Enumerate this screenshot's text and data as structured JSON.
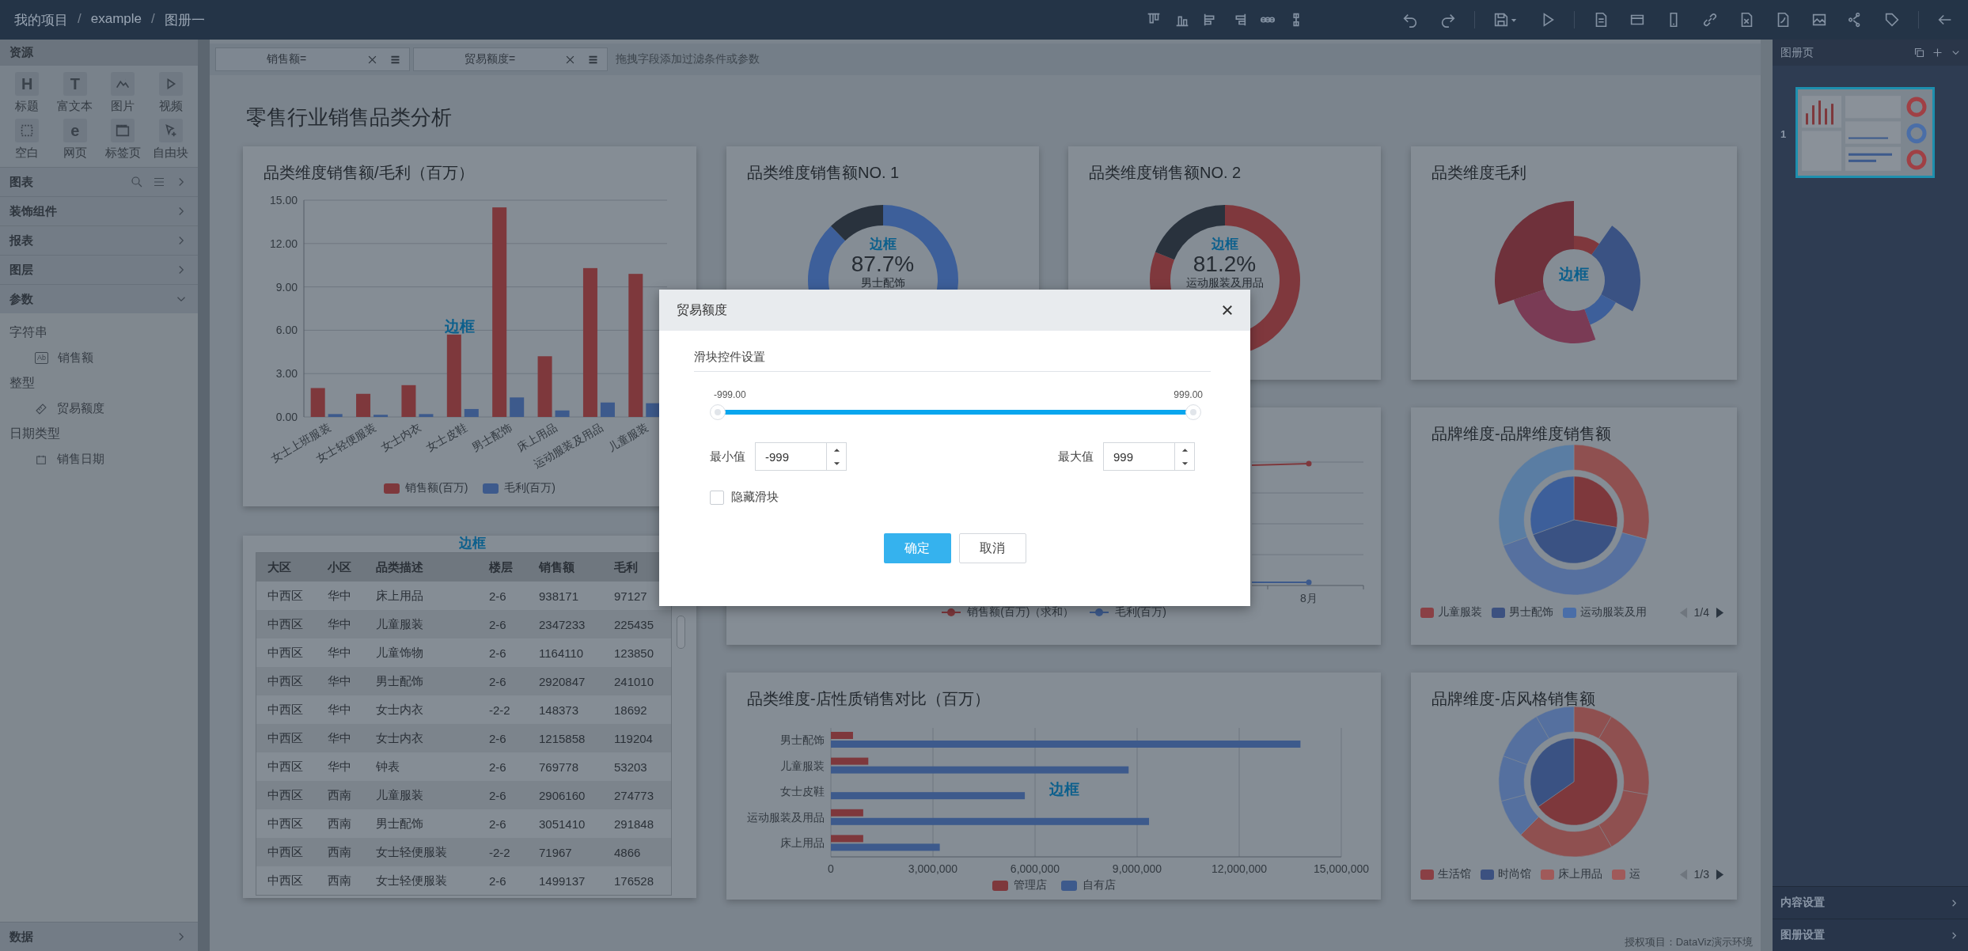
{
  "topbar": {
    "breadcrumb": [
      {
        "text": "我的项目",
        "kind": "link"
      },
      {
        "text": "/",
        "kind": "separator"
      },
      {
        "text": "example",
        "kind": "link"
      },
      {
        "text": "/",
        "kind": "separator"
      },
      {
        "text": "图册一",
        "kind": "current"
      }
    ]
  },
  "sidebar": {
    "title": "资源",
    "widgets": [
      {
        "label": "标题",
        "kind": "glyph",
        "glyph": "H"
      },
      {
        "label": "富文本",
        "kind": "glyph",
        "glyph": "T"
      },
      {
        "label": "图片",
        "kind": "image"
      },
      {
        "label": "视频",
        "kind": "video"
      },
      {
        "label": "空白",
        "kind": "blank"
      },
      {
        "label": "网页",
        "kind": "glyph",
        "glyph": "e"
      },
      {
        "label": "标签页",
        "kind": "tab"
      },
      {
        "label": "自由块",
        "kind": "free"
      }
    ],
    "sections": [
      {
        "label": "图表",
        "kind": "tools",
        "expanded": false
      },
      {
        "label": "装饰组件",
        "kind": "plain",
        "expanded": false
      },
      {
        "label": "报表",
        "kind": "plain",
        "expanded": false
      },
      {
        "label": "图层",
        "kind": "plain",
        "expanded": false
      },
      {
        "label": "参数",
        "kind": "plain",
        "expanded": true,
        "children": [
          {
            "label": "字符串",
            "children": [
              {
                "label": "销售额",
                "kind": "text",
                "glyph": "Ab"
              }
            ]
          },
          {
            "label": "整型",
            "children": [
              {
                "label": "贸易额度",
                "kind": "number"
              }
            ]
          },
          {
            "label": "日期类型",
            "children": [
              {
                "label": "销售日期",
                "kind": "date"
              }
            ]
          }
        ]
      }
    ],
    "footer": {
      "label": "数据",
      "expanded": false
    }
  },
  "filters": {
    "chips": [
      {
        "label": "销售额="
      },
      {
        "label": "贸易额度="
      }
    ],
    "hint": "拖拽字段添加过滤条件或参数"
  },
  "page": {
    "title": "零售行业销售品类分析",
    "bar_card": {
      "overlay": "边框",
      "chart_data": {
        "type": "bar",
        "title": "品类维度销售额/毛利（百万）",
        "categories": [
          "女士上班服装",
          "女士轻便服装",
          "女士内衣",
          "女士皮鞋",
          "男士配饰",
          "床上用品",
          "运动服装及用品",
          "儿童服装"
        ],
        "series": [
          {
            "name": "销售额(百万)",
            "color": "#7e383c",
            "values": [
              2.0,
              1.6,
              2.2,
              5.7,
              14.5,
              4.2,
              10.3,
              9.9
            ]
          },
          {
            "name": "毛利(百万)",
            "color": "#3d5a8c",
            "values": [
              0.2,
              0.15,
              0.2,
              0.55,
              1.35,
              0.45,
              1.0,
              0.95
            ]
          }
        ],
        "grid": true,
        "ylim": [
          0,
          15
        ],
        "yticks": [
          {
            "value": 0,
            "label": "0.00"
          },
          {
            "value": 3,
            "label": "3.00"
          },
          {
            "value": 6,
            "label": "6.00"
          },
          {
            "value": 9,
            "label": "9.00"
          },
          {
            "value": 12,
            "label": "12.00"
          },
          {
            "value": 15,
            "label": "15.00"
          }
        ]
      }
    },
    "donut_cards": [
      {
        "title": "品类维度销售额NO. 1",
        "overlay": "边框",
        "percent": "87.7%",
        "name": "男士配饰"
      },
      {
        "title": "品类维度销售额NO. 2",
        "overlay": "边框",
        "percent": "81.2%",
        "name": "运动服装及用品"
      }
    ],
    "rose_card": {
      "title": "品类维度毛利",
      "overlay": "边框"
    },
    "line_card": {
      "x_label": "8月",
      "legend": [
        {
          "name": "销售额(百万)（求和）",
          "color": "#7e383c"
        },
        {
          "name": "毛利(百万)",
          "color": "#3d5a8c"
        }
      ]
    },
    "brand_card": {
      "title": "品牌维度-品牌维度销售额",
      "legend": [
        {
          "name": "儿童服装",
          "color": "#8a4045"
        },
        {
          "name": "男士配饰",
          "color": "#3c5180"
        },
        {
          "name": "运动服装及用",
          "color": "#4a6ea8"
        }
      ],
      "pager": "1/4"
    },
    "table_card": {
      "overlay": "边框",
      "columns": [
        "大区",
        "小区",
        "品类描述",
        "楼层",
        "销售额",
        "毛利"
      ],
      "rows": [
        [
          "中西区",
          "华中",
          "床上用品",
          "2-6",
          "938171",
          "97127"
        ],
        [
          "中西区",
          "华中",
          "儿童服装",
          "2-6",
          "2347233",
          "225435"
        ],
        [
          "中西区",
          "华中",
          "儿童饰物",
          "2-6",
          "1164110",
          "123850"
        ],
        [
          "中西区",
          "华中",
          "男士配饰",
          "2-6",
          "2920847",
          "241010"
        ],
        [
          "中西区",
          "华中",
          "女士内衣",
          "-2-2",
          "148373",
          "18692"
        ],
        [
          "中西区",
          "华中",
          "女士内衣",
          "2-6",
          "1215858",
          "119204"
        ],
        [
          "中西区",
          "华中",
          "钟表",
          "2-6",
          "769778",
          "53203"
        ],
        [
          "中西区",
          "西南",
          "儿童服装",
          "2-6",
          "2906160",
          "274773"
        ],
        [
          "中西区",
          "西南",
          "男士配饰",
          "2-6",
          "3051410",
          "291848"
        ],
        [
          "中西区",
          "西南",
          "女士轻便服装",
          "-2-2",
          "71967",
          "4866"
        ],
        [
          "中西区",
          "西南",
          "女士轻便服装",
          "2-6",
          "1499137",
          "176528"
        ]
      ]
    },
    "hbar_card": {
      "overlay": "边框",
      "chart_data": {
        "type": "bar",
        "orientation": "horizontal",
        "title": "品类维度-店性质销售对比（百万）",
        "categories": [
          "男士配饰",
          "儿童服装",
          "女士皮鞋",
          "运动服装及用品",
          "床上用品"
        ],
        "series": [
          {
            "name": "管理店",
            "color": "#7e383c",
            "values": [
              650000,
              1100000,
              null,
              950000,
              950000
            ]
          },
          {
            "name": "自有店",
            "color": "#3d5a8c",
            "values": [
              13800000,
              8750000,
              5700000,
              9350000,
              3200000
            ]
          }
        ],
        "grid": true,
        "xlim": [
          0,
          15000000
        ],
        "xticks": [
          {
            "value": 0,
            "label": "0"
          },
          {
            "value": 3000000,
            "label": "3,000,000"
          },
          {
            "value": 6000000,
            "label": "6,000,000"
          },
          {
            "value": 9000000,
            "label": "9,000,000"
          },
          {
            "value": 12000000,
            "label": "12,000,000"
          },
          {
            "value": 15000000,
            "label": "15,000,000"
          }
        ]
      }
    },
    "style_card": {
      "title": "品牌维度-店风格销售额",
      "legend": [
        {
          "name": "生活馆",
          "color": "#8a4045"
        },
        {
          "name": "时尚馆",
          "color": "#3c5180"
        },
        {
          "name": "床上用品",
          "color": "#a05a5a"
        },
        {
          "name": "运",
          "color": "#a05a5a"
        }
      ],
      "pager": "1/3"
    },
    "status": "授权项目：DataViz演示环境"
  },
  "right_panel": {
    "title": "图册页",
    "pages": [
      {
        "number": "1",
        "selected": true
      }
    ],
    "sections": [
      {
        "label": "内容设置"
      },
      {
        "label": "图册设置"
      }
    ]
  },
  "dialog": {
    "title": "贸易额度",
    "tab": "滑块控件设置",
    "slider": {
      "min_label": "-999.00",
      "max_label": "999.00",
      "level": 1
    },
    "min": {
      "label": "最小值",
      "value": "-999"
    },
    "max": {
      "label": "最大值",
      "value": "999"
    },
    "hide_slider": {
      "label": "隐藏滑块",
      "checked": false
    },
    "buttons": [
      {
        "label": "确定",
        "kind": "primary"
      },
      {
        "label": "取消",
        "kind": "default"
      }
    ]
  }
}
